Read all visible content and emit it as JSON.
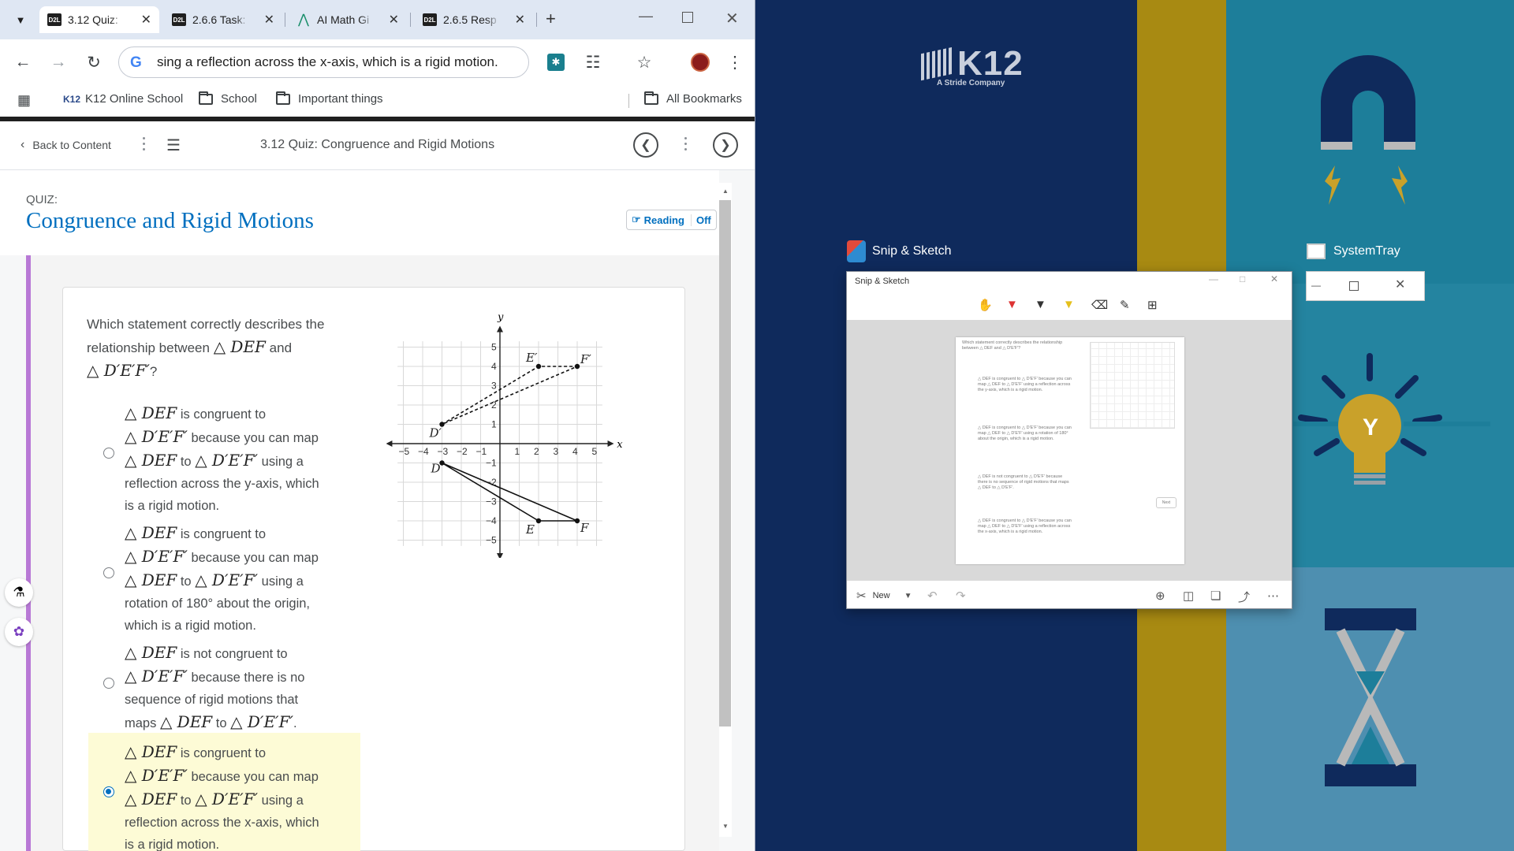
{
  "browser": {
    "tabs": [
      {
        "label": "3.12 Quiz:",
        "favicon": "D2L",
        "active": true
      },
      {
        "label": "2.6.6 Task:",
        "favicon": "D2L",
        "active": false
      },
      {
        "label": "AI Math Gi",
        "favicon": "math-icon",
        "active": false
      },
      {
        "label": "2.6.5 Resp",
        "favicon": "D2L",
        "active": false
      }
    ],
    "new_tab_glyph": "+",
    "address": "sing a reflection across the x-axis, which is a rigid motion.",
    "bookmarks": [
      {
        "label": "K12 Online School",
        "badge": "K12"
      },
      {
        "label": "School"
      },
      {
        "label": "Important things"
      }
    ],
    "all_bookmarks": "All Bookmarks"
  },
  "d2l": {
    "back_label": "Back to Content",
    "page_title": "3.12 Quiz: Congruence and Rigid Motions",
    "quiz_kicker": "QUIZ:",
    "quiz_title": "Congruence and Rigid Motions",
    "reading_label": "Reading",
    "reading_state": "Off"
  },
  "question": {
    "line1": "Which statement correctly describes the",
    "line2a": "relationship between",
    "tri1": "△ DEF",
    "line2b": "and",
    "tri2": "△ D′E′F′",
    "qmark": "?",
    "options": [
      {
        "a": "△ DEF",
        "a_txt": " is congruent to",
        "b": "△ D′E′F′",
        "b_txt": " because you can map",
        "c": "△ DEF",
        "c_mid": " to ",
        "c2": "△ D′E′F′",
        "c_txt": " using a",
        "d": "reflection across the y-axis, which",
        "e": "is a rigid motion.",
        "selected": false
      },
      {
        "a": "△ DEF",
        "a_txt": " is congruent to",
        "b": "△ D′E′F′",
        "b_txt": " because you can map",
        "c": "△ DEF",
        "c_mid": " to ",
        "c2": "△ D′E′F′",
        "c_txt": " using a",
        "d": "rotation of 180° about the origin,",
        "e": "which is a rigid motion.",
        "selected": false
      },
      {
        "a": "△ DEF",
        "a_txt": " is not congruent to",
        "b": "△ D′E′F′",
        "b_txt": " because there is no",
        "d": "sequence of rigid motions that",
        "e_pre": "maps ",
        "e1": "△ DEF",
        "e_mid": " to ",
        "e2": "△ D′E′F′",
        "e_end": ".",
        "selected": false
      },
      {
        "a": "△ DEF",
        "a_txt": " is congruent to",
        "b": "△ D′E′F′",
        "b_txt": " because you can map",
        "c": "△ DEF",
        "c_mid": " to ",
        "c2": "△ D′E′F′",
        "c_txt": " using a",
        "d": "reflection across the x-axis, which",
        "e": "is a rigid motion.",
        "selected": true
      }
    ]
  },
  "graph": {
    "x_label": "x",
    "y_label": "y",
    "x_ticks": [
      "−5",
      "−4",
      "−3",
      "−2",
      "−1",
      "1",
      "2",
      "3",
      "4",
      "5"
    ],
    "y_ticks": [
      "5",
      "4",
      "3",
      "2",
      "1",
      "−1",
      "−2",
      "−3",
      "−4",
      "−5"
    ],
    "points": {
      "D": {
        "label": "D",
        "x": -3,
        "y": -1
      },
      "E": {
        "label": "E",
        "x": 2,
        "y": -4
      },
      "F": {
        "label": "F",
        "x": 4,
        "y": -4
      },
      "Dp": {
        "label": "D′",
        "x": -3,
        "y": 1
      },
      "Ep": {
        "label": "E′",
        "x": 2,
        "y": 4
      },
      "Fp": {
        "label": "F′",
        "x": 4,
        "y": 4
      }
    }
  },
  "desktop": {
    "k12_logo": "K12",
    "k12_tagline": "A Stride Company",
    "snip_label": "Snip & Sketch",
    "systray_label": "SystemTray"
  },
  "snip": {
    "title": "Snip & Sketch",
    "new_label": "New",
    "next_label": "Next"
  }
}
